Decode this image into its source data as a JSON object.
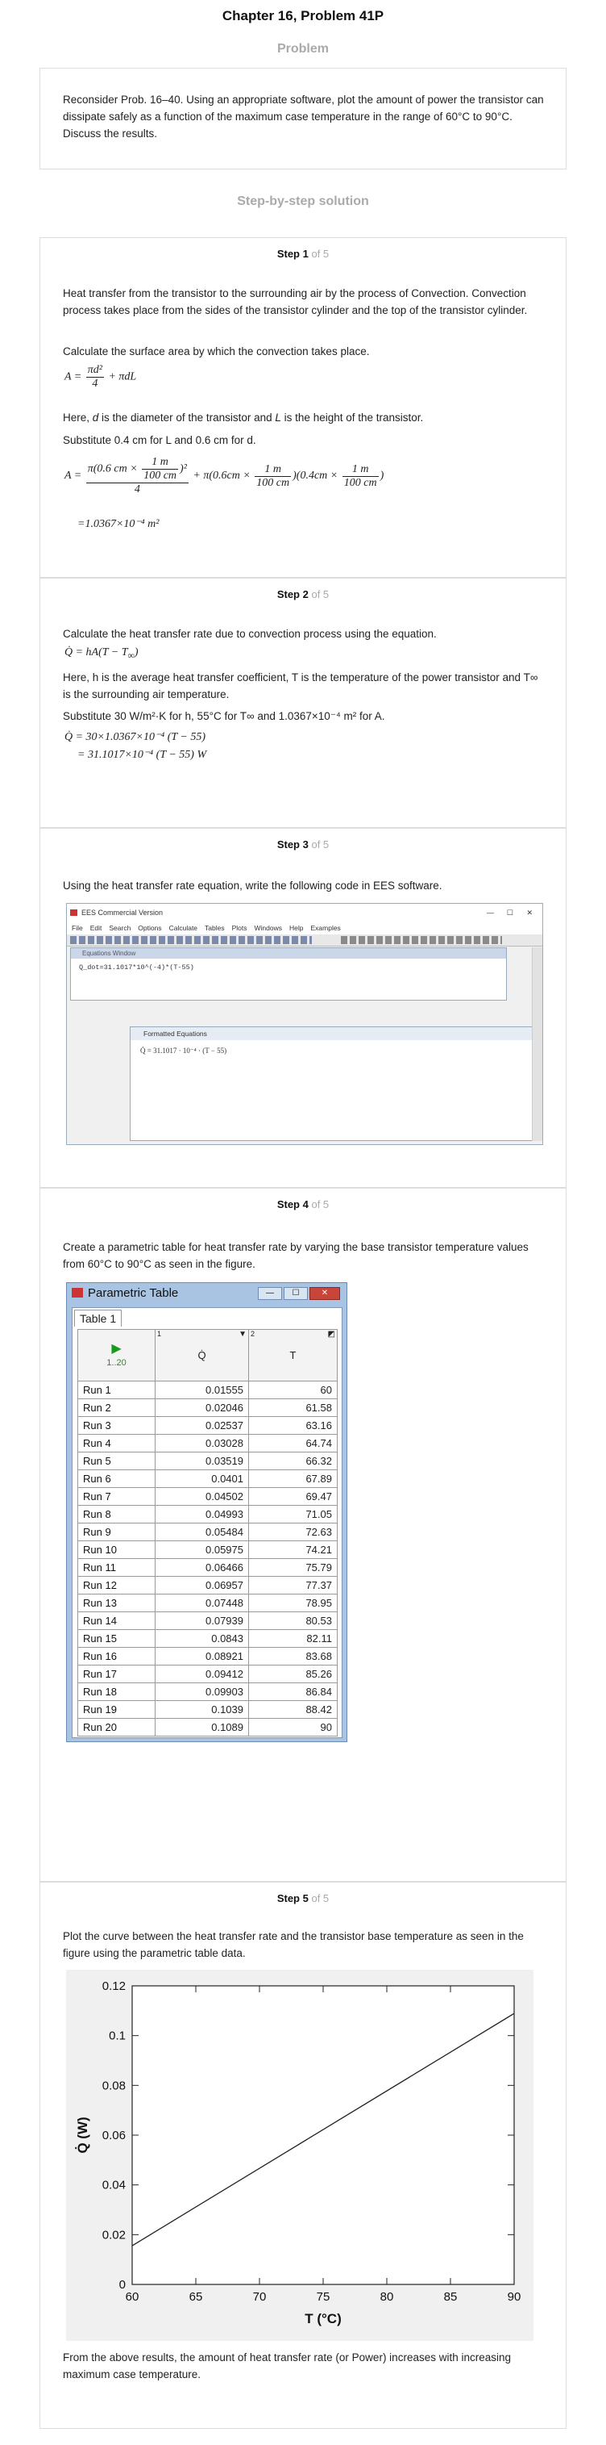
{
  "header": {
    "title": "Chapter 16, Problem 41P",
    "problem_heading": "Problem",
    "solution_heading": "Step-by-step solution"
  },
  "problem": {
    "text": "Reconsider Prob. 16–40. Using an appropriate software, plot the amount of power the transistor can dissipate safely as a function of the maximum case temperature in the range of 60°C to 90°C. Discuss the results."
  },
  "steps": [
    {
      "label": "Step 1",
      "of": "of 5",
      "p1": "Heat transfer from the transistor to the surrounding air by the process of Convection. Convection process takes place from the sides of the transistor cylinder and the top of the transistor cylinder.",
      "p2": "Calculate the surface area by which the convection takes place.",
      "p3a": "Here, ",
      "p3b": " is the diameter of the transistor and ",
      "p3c": " is the height of the transistor.",
      "p4": "Substitute 0.4 cm for L and 0.6 cm for d.",
      "result": "=1.0367×10⁻⁴ m²"
    },
    {
      "label": "Step 2",
      "of": "of 5",
      "p1": "Calculate the heat transfer rate due to convection process using the equation.",
      "p2": "Here, h is the average heat transfer coefficient, T is the temperature of the power transistor and T∞ is the surrounding air temperature.",
      "p3": "Substitute 30 W/m²·K for h, 55°C for T∞ and 1.0367×10⁻⁴ m² for A.",
      "eq1": "Q̇ = 30×1.0367×10⁻⁴ (T − 55)",
      "eq2": "= 31.1017×10⁻⁴ (T − 55) W"
    },
    {
      "label": "Step 3",
      "of": "of 5",
      "p1": "Using the heat transfer rate equation, write the following code in EES software."
    },
    {
      "label": "Step 4",
      "of": "of 5",
      "p1": "Create a parametric table for heat transfer rate by varying the base transistor temperature values from 60°C to 90°C as seen in the figure."
    },
    {
      "label": "Step 5",
      "of": "of 5",
      "p1": "Plot the curve between the heat transfer rate and the transistor base temperature as seen in the figure using the parametric table data.",
      "p2": "From the above results, the amount of heat transfer rate (or Power) increases with increasing maximum case temperature."
    }
  ],
  "ees": {
    "window_title": "EES Commercial Version",
    "menu": [
      "File",
      "Edit",
      "Search",
      "Options",
      "Calculate",
      "Tables",
      "Plots",
      "Windows",
      "Help",
      "Examples"
    ],
    "equations_title": "Equations Window",
    "code": "Q_dot=31.1017*10^(-4)*(T-55)",
    "formatted_title": "Formatted Equations",
    "formatted": "Q̇  =  31.1017 · 10⁻⁴ · (T − 55)"
  },
  "parametric": {
    "title": "Parametric Table",
    "tab": "Table 1",
    "range": "1..20",
    "col_q": "Q̇",
    "col_t": "T",
    "col_q_num": "1",
    "col_t_num": "2",
    "rows": [
      [
        "Run 1",
        "0.01555",
        "60"
      ],
      [
        "Run 2",
        "0.02046",
        "61.58"
      ],
      [
        "Run 3",
        "0.02537",
        "63.16"
      ],
      [
        "Run 4",
        "0.03028",
        "64.74"
      ],
      [
        "Run 5",
        "0.03519",
        "66.32"
      ],
      [
        "Run 6",
        "0.0401",
        "67.89"
      ],
      [
        "Run 7",
        "0.04502",
        "69.47"
      ],
      [
        "Run 8",
        "0.04993",
        "71.05"
      ],
      [
        "Run 9",
        "0.05484",
        "72.63"
      ],
      [
        "Run 10",
        "0.05975",
        "74.21"
      ],
      [
        "Run 11",
        "0.06466",
        "75.79"
      ],
      [
        "Run 12",
        "0.06957",
        "77.37"
      ],
      [
        "Run 13",
        "0.07448",
        "78.95"
      ],
      [
        "Run 14",
        "0.07939",
        "80.53"
      ],
      [
        "Run 15",
        "0.0843",
        "82.11"
      ],
      [
        "Run 16",
        "0.08921",
        "83.68"
      ],
      [
        "Run 17",
        "0.09412",
        "85.26"
      ],
      [
        "Run 18",
        "0.09903",
        "86.84"
      ],
      [
        "Run 19",
        "0.1039",
        "88.42"
      ],
      [
        "Run 20",
        "0.1089",
        "90"
      ]
    ]
  },
  "chart_data": {
    "type": "line",
    "xlabel": "T (°C)",
    "ylabel": "Q̇ (W)",
    "xlim": [
      60,
      90
    ],
    "ylim": [
      0,
      0.12
    ],
    "xticks": [
      60,
      65,
      70,
      75,
      80,
      85,
      90
    ],
    "yticks": [
      0,
      0.02,
      0.04,
      0.06,
      0.08,
      0.1,
      0.12
    ],
    "x": [
      60,
      90
    ],
    "y": [
      0.01555,
      0.1089
    ],
    "grid": false
  }
}
